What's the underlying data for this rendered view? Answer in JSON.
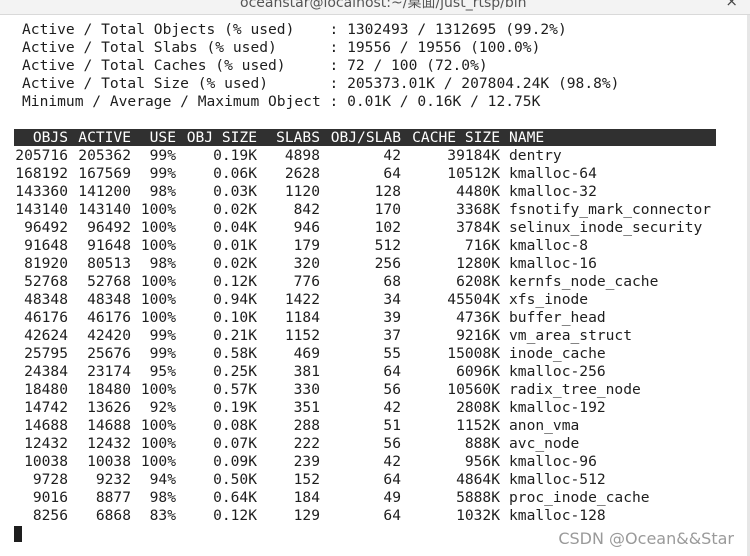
{
  "window": {
    "title": "oceanstar@localhost:~/桌面/just_rtsp/bin",
    "close_glyph": "×"
  },
  "summary": {
    "lines": [
      "Active / Total Objects (% used)    : 1302493 / 1312695 (99.2%)",
      "Active / Total Slabs (% used)      : 19556 / 19556 (100.0%)",
      "Active / Total Caches (% used)     : 72 / 100 (72.0%)",
      "Active / Total Size (% used)       : 205373.01K / 207804.24K (98.8%)",
      "Minimum / Average / Maximum Object : 0.01K / 0.16K / 12.75K"
    ]
  },
  "table": {
    "headers": [
      "OBJS",
      "ACTIVE",
      "USE",
      "OBJ SIZE",
      "SLABS",
      "OBJ/SLAB",
      "CACHE SIZE",
      "NAME"
    ],
    "rows": [
      [
        "205716",
        "205362",
        "99%",
        "0.19K",
        "4898",
        "42",
        "39184K",
        "dentry"
      ],
      [
        "168192",
        "167569",
        "99%",
        "0.06K",
        "2628",
        "64",
        "10512K",
        "kmalloc-64"
      ],
      [
        "143360",
        "141200",
        "98%",
        "0.03K",
        "1120",
        "128",
        "4480K",
        "kmalloc-32"
      ],
      [
        "143140",
        "143140",
        "100%",
        "0.02K",
        "842",
        "170",
        "3368K",
        "fsnotify_mark_connector"
      ],
      [
        "96492",
        "96492",
        "100%",
        "0.04K",
        "946",
        "102",
        "3784K",
        "selinux_inode_security"
      ],
      [
        "91648",
        "91648",
        "100%",
        "0.01K",
        "179",
        "512",
        "716K",
        "kmalloc-8"
      ],
      [
        "81920",
        "80513",
        "98%",
        "0.02K",
        "320",
        "256",
        "1280K",
        "kmalloc-16"
      ],
      [
        "52768",
        "52768",
        "100%",
        "0.12K",
        "776",
        "68",
        "6208K",
        "kernfs_node_cache"
      ],
      [
        "48348",
        "48348",
        "100%",
        "0.94K",
        "1422",
        "34",
        "45504K",
        "xfs_inode"
      ],
      [
        "46176",
        "46176",
        "100%",
        "0.10K",
        "1184",
        "39",
        "4736K",
        "buffer_head"
      ],
      [
        "42624",
        "42420",
        "99%",
        "0.21K",
        "1152",
        "37",
        "9216K",
        "vm_area_struct"
      ],
      [
        "25795",
        "25676",
        "99%",
        "0.58K",
        "469",
        "55",
        "15008K",
        "inode_cache"
      ],
      [
        "24384",
        "23174",
        "95%",
        "0.25K",
        "381",
        "64",
        "6096K",
        "kmalloc-256"
      ],
      [
        "18480",
        "18480",
        "100%",
        "0.57K",
        "330",
        "56",
        "10560K",
        "radix_tree_node"
      ],
      [
        "14742",
        "13626",
        "92%",
        "0.19K",
        "351",
        "42",
        "2808K",
        "kmalloc-192"
      ],
      [
        "14688",
        "14688",
        "100%",
        "0.08K",
        "288",
        "51",
        "1152K",
        "anon_vma"
      ],
      [
        "12432",
        "12432",
        "100%",
        "0.07K",
        "222",
        "56",
        "888K",
        "avc_node"
      ],
      [
        "10038",
        "10038",
        "100%",
        "0.09K",
        "239",
        "42",
        "956K",
        "kmalloc-96"
      ],
      [
        "9728",
        "9232",
        "94%",
        "0.50K",
        "152",
        "64",
        "4864K",
        "kmalloc-512"
      ],
      [
        "9016",
        "8877",
        "98%",
        "0.64K",
        "184",
        "49",
        "5888K",
        "proc_inode_cache"
      ],
      [
        "8256",
        "6868",
        "83%",
        "0.12K",
        "129",
        "64",
        "1032K",
        "kmalloc-128"
      ]
    ]
  },
  "watermark": "CSDN @Ocean&&Star"
}
